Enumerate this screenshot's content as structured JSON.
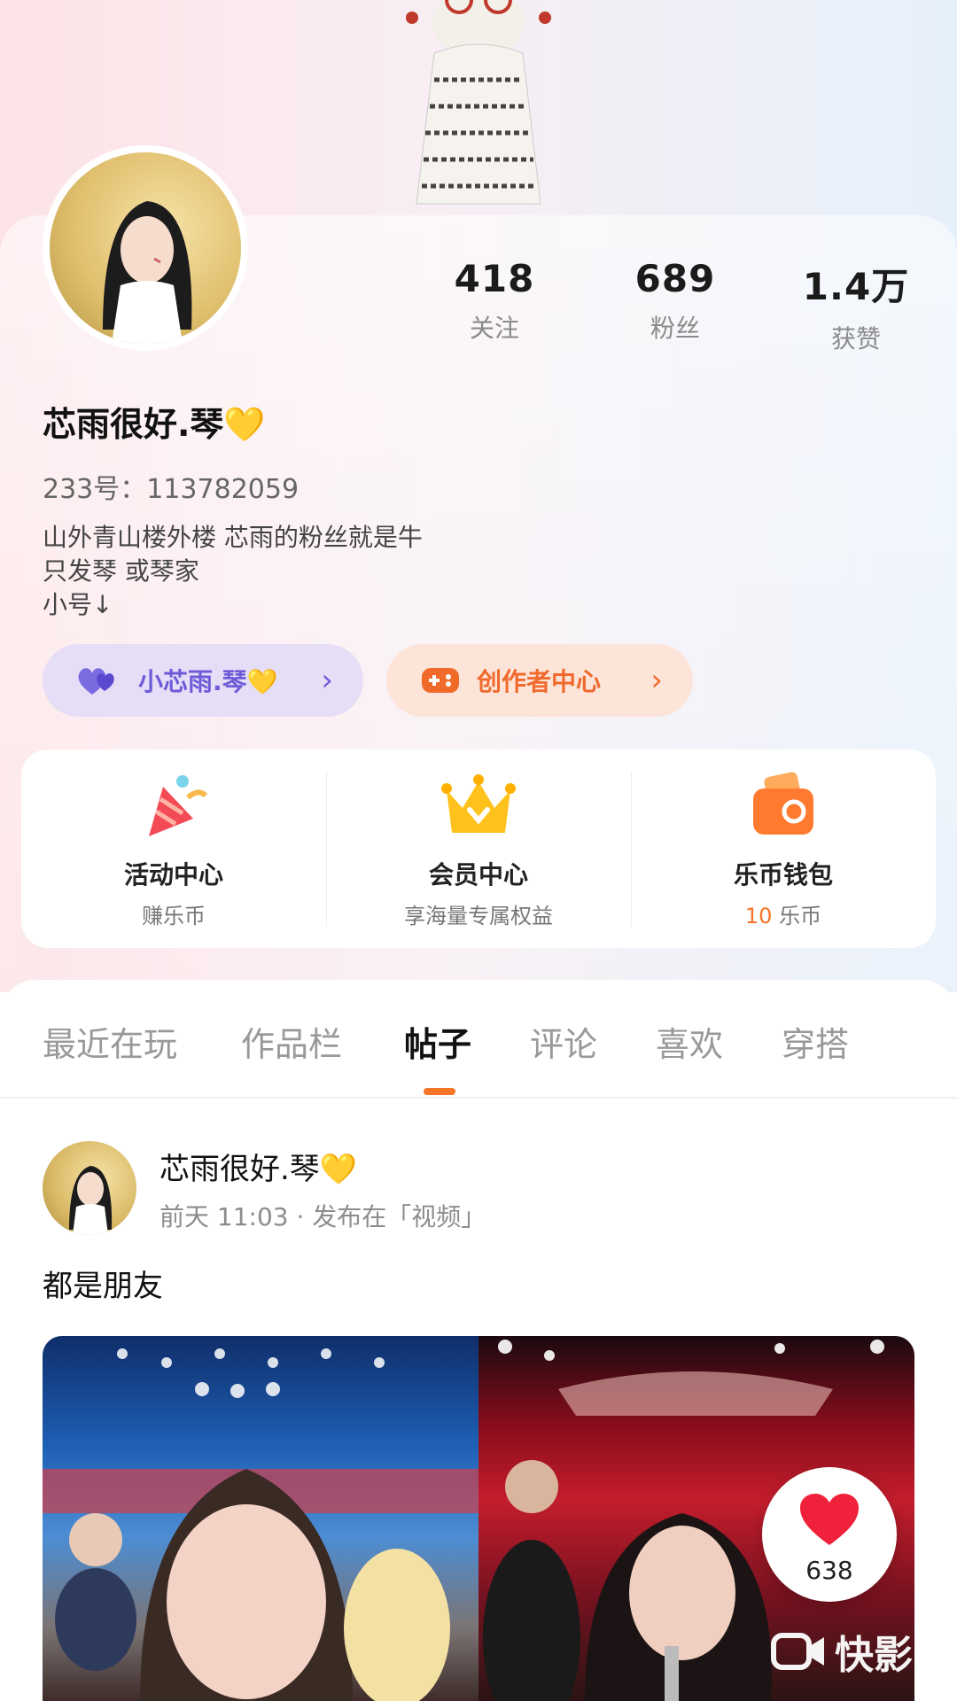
{
  "profile": {
    "stats": [
      {
        "value": "418",
        "label": "关注"
      },
      {
        "value": "689",
        "label": "粉丝"
      },
      {
        "value": "1.4万",
        "label": "获赞"
      }
    ],
    "nickname": "芯雨很好.琴💛",
    "uid": "233号：113782059",
    "bio": [
      "山外青山楼外楼  芯雨的粉丝就是牛",
      "只发琴  或琴家",
      "小号↓"
    ],
    "sub_account_label": "小芯雨.琴💛",
    "creator_label": "创作者中心"
  },
  "quick_entries": [
    {
      "title": "活动中心",
      "subtitle": "赚乐币",
      "icon": "party-popper-icon"
    },
    {
      "title": "会员中心",
      "subtitle": "享海量专属权益",
      "icon": "crown-icon"
    },
    {
      "title": "乐币钱包",
      "subtitle_value": "10",
      "subtitle_unit": " 乐币",
      "icon": "wallet-icon"
    }
  ],
  "tabs": [
    "最近在玩",
    "作品栏",
    "帖子",
    "评论",
    "喜欢",
    "穿搭"
  ],
  "active_tab": "帖子",
  "post": {
    "author": "芯雨很好.琴💛",
    "meta": "前天 11:03 · 发布在「视频」",
    "text": "都是朋友",
    "like_count": "638"
  },
  "watermark": "快影",
  "colors": {
    "accent": "#f57428",
    "sub_pill": "#6d5bd8",
    "creator_pill": "#ef6a2c",
    "like": "#f0213a"
  }
}
